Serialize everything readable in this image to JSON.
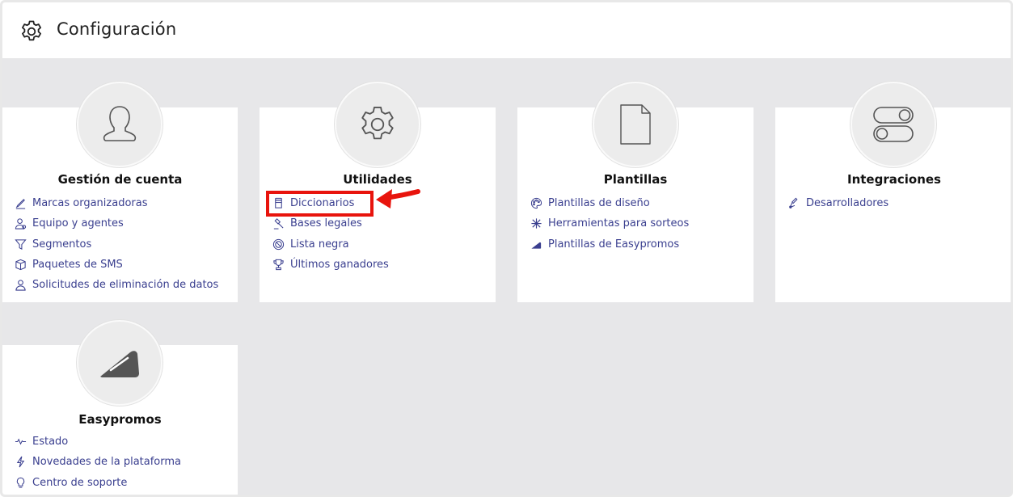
{
  "header": {
    "title": "Configuración",
    "icon": "gear-icon"
  },
  "colors": {
    "link": "#3a3f8f",
    "background": "#e7e7e9",
    "highlight": "#e8140d",
    "icon_bg": "#ececec"
  },
  "cards": {
    "cuenta": {
      "title": "Gestión de cuenta",
      "icon": "user-icon",
      "items": [
        {
          "label": "Marcas organizadoras",
          "icon": "pen-icon"
        },
        {
          "label": "Equipo y agentes",
          "icon": "people-icon"
        },
        {
          "label": "Segmentos",
          "icon": "filter-icon"
        },
        {
          "label": "Paquetes de SMS",
          "icon": "package-icon"
        },
        {
          "label": "Solicitudes de eliminación de datos",
          "icon": "user-outline-icon"
        }
      ]
    },
    "utilidades": {
      "title": "Utilidades",
      "icon": "gear-icon",
      "items": [
        {
          "label": "Diccionarios",
          "icon": "jar-icon"
        },
        {
          "label": "Bases legales",
          "icon": "gavel-icon"
        },
        {
          "label": "Lista negra",
          "icon": "ban-icon"
        },
        {
          "label": "Últimos ganadores",
          "icon": "trophy-icon"
        }
      ]
    },
    "plantillas": {
      "title": "Plantillas",
      "icon": "document-icon",
      "items": [
        {
          "label": "Plantillas de diseño",
          "icon": "palette-icon"
        },
        {
          "label": "Herramientas para sorteos",
          "icon": "tools-icon"
        },
        {
          "label": "Plantillas de Easypromos",
          "icon": "easypromos-icon"
        }
      ]
    },
    "integraciones": {
      "title": "Integraciones",
      "icon": "toggles-icon",
      "items": [
        {
          "label": "Desarrolladores",
          "icon": "developer-icon"
        }
      ]
    },
    "easypromos": {
      "title": "Easypromos",
      "icon": "easypromos-logo-icon",
      "items": [
        {
          "label": "Estado",
          "icon": "heartbeat-icon"
        },
        {
          "label": "Novedades de la plataforma",
          "icon": "bolt-icon"
        },
        {
          "label": "Centro de soporte",
          "icon": "lightbulb-icon"
        }
      ]
    }
  }
}
